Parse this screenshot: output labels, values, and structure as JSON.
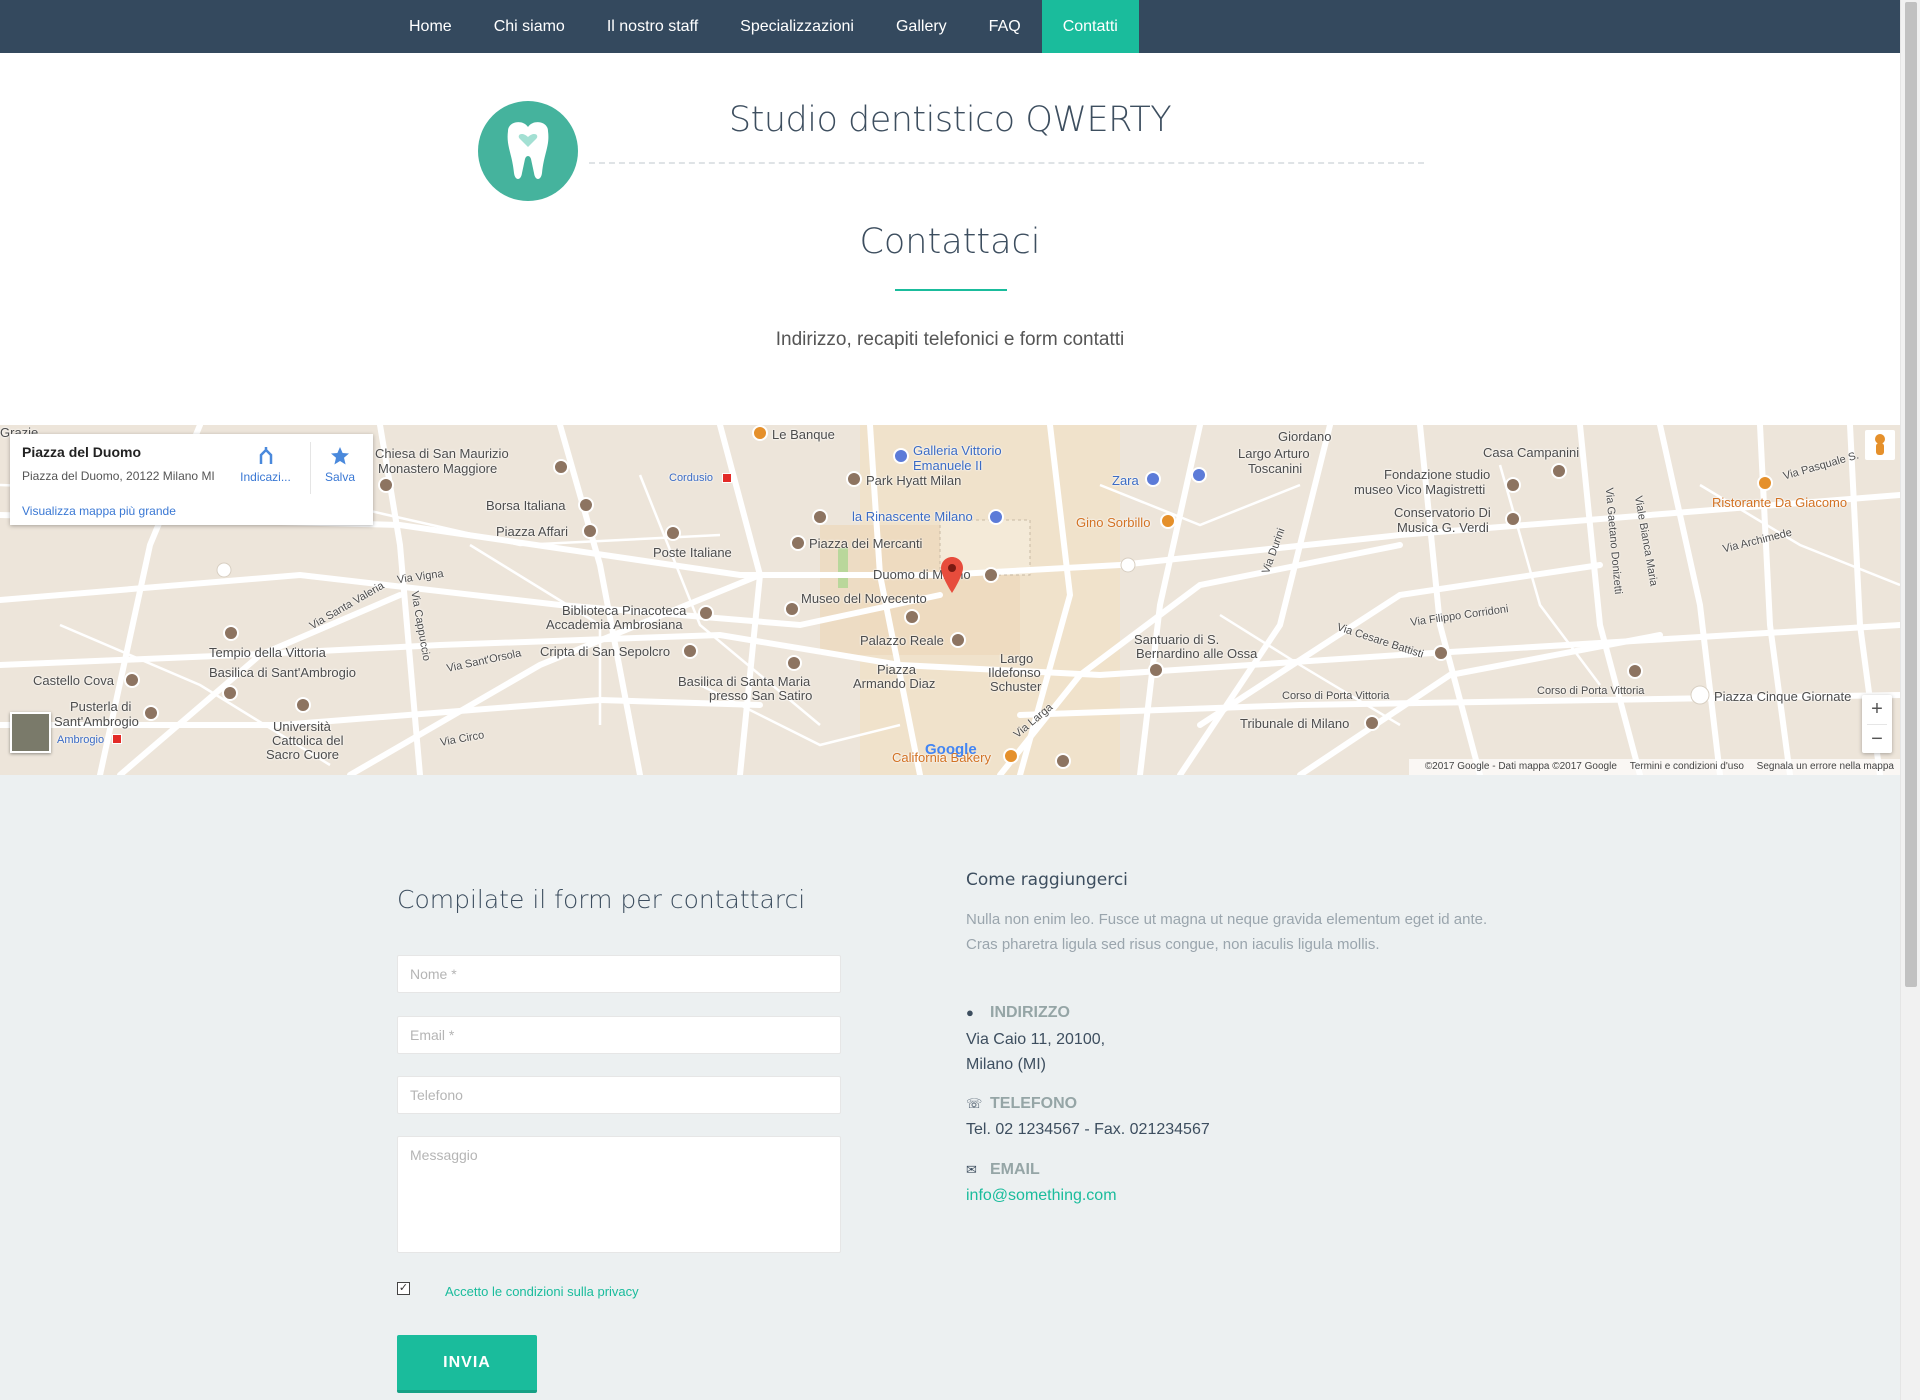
{
  "nav": {
    "items": [
      {
        "label": "Home",
        "active": false
      },
      {
        "label": "Chi siamo",
        "active": false
      },
      {
        "label": "Il nostro staff",
        "active": false
      },
      {
        "label": "Specializzazioni",
        "active": false
      },
      {
        "label": "Gallery",
        "active": false
      },
      {
        "label": "FAQ",
        "active": false
      },
      {
        "label": "Contatti",
        "active": true
      }
    ]
  },
  "header": {
    "brand": "Studio dentistico QWERTY",
    "logo_icon": "tooth-heart-icon"
  },
  "intro": {
    "title": "Contattaci",
    "subtitle": "Indirizzo, recapiti telefonici e form contatti"
  },
  "map": {
    "place_name": "Piazza del Duomo",
    "place_address": "Piazza del Duomo, 20122 Milano MI",
    "directions_label": "Indicazi...",
    "save_label": "Salva",
    "larger_map_link": "Visualizza mappa più grande",
    "zoom_in": "+",
    "zoom_out": "−",
    "google_logo": "Google",
    "footer": {
      "copyright": "©2017 Google - Dati mappa ©2017 Google",
      "terms": "Termini e condizioni d'uso",
      "report": "Segnala un errore nella mappa"
    },
    "labels": {
      "le_banque": "Le Banque",
      "galleria": "Galleria Vittorio",
      "galleria2": "Emanuele II",
      "park_hyatt": "Park Hyatt Milan",
      "rinascente": "la Rinascente Milano",
      "zara": "Zara",
      "gino": "Gino Sorbillo",
      "largo_toscanini": "Largo Arturo",
      "largo_toscanini2": "Toscanini",
      "giordano": "Giordano",
      "casa_campanini": "Casa Campanini",
      "fondazione": "Fondazione studio",
      "fondazione2": "museo Vico Magistretti",
      "conservatorio": "Conservatorio Di",
      "conservatorio2": "Musica G. Verdi",
      "ristorante": "Ristorante Da Giacomo",
      "santa_maurizio": "Chiesa di San Maurizio",
      "santa_maurizio2": "Monastero Maggiore",
      "borsa": "Borsa Italiana",
      "piazza_affari": "Piazza Affari",
      "poste": "Poste Italiane",
      "cordusio": "Cordusio",
      "mercanti": "Piazza dei Mercanti",
      "duomo": "Duomo di Milano",
      "novecento": "Museo del Novecento",
      "palazzo_reale": "Palazzo Reale",
      "biblioteca": "Biblioteca Pinacoteca",
      "biblioteca2": "Accademia Ambrosiana",
      "cripta": "Cripta di San Sepolcro",
      "tempio": "Tempio della Vittoria",
      "basilica_ambrogio": "Basilica di Sant'Ambrogio",
      "castello_cova": "Castello Cova",
      "pusterla": "Pusterla di",
      "pusterla2": "Sant'Ambrogio",
      "cattolica": "Università",
      "cattolica2": "Cattolica del",
      "cattolica3": "Sacro Cuore",
      "ambrogio_metro": "Ambrogio",
      "basilica_satiro": "Basilica di Santa Maria",
      "basilica_satiro2": "presso San Satiro",
      "armando_diaz": "Piazza",
      "armando_diaz2": "Armando Diaz",
      "largo_schuster": "Largo",
      "largo_schuster2": "Ildefonso",
      "largo_schuster3": "Schuster",
      "santuario": "Santuario di S.",
      "santuario2": "Bernardino alle Ossa",
      "corso_vittoria": "Corso di Porta Vittoria",
      "tribunale": "Tribunale di Milano",
      "cinque_giornate": "Piazza Cinque Giornate",
      "california": "California Bakery",
      "corso_porta_vittoria": "Corso di Porta Vittoria",
      "via_corridoni": "Via Filippo Corridoni",
      "via_battisti": "Via Cesare Battisti",
      "via_vigna": "Via Vigna",
      "via_orsola": "Via Sant'Orsola",
      "via_valeria": "Via Santa Valeria",
      "via_cappuccio": "Via Cappuccio",
      "via_circo": "Via Circo",
      "via_archimede": "Via Archimede",
      "via_pasquale": "Via Pasquale S.",
      "via_donizetti": "Via Gaetano Donizetti",
      "viale_bianca": "Viale Bianca Maria",
      "via_durini": "Via Durini",
      "via_larga": "Via Larga",
      "grazie": "Grazie"
    }
  },
  "form": {
    "title": "Compilate il form per contattarci",
    "name_placeholder": "Nome *",
    "email_placeholder": "Email *",
    "phone_placeholder": "Telefono",
    "message_placeholder": "Messaggio",
    "privacy_label": "Accetto le condizioni sulla privacy",
    "privacy_checked": true,
    "submit_label": "INVIA"
  },
  "reach": {
    "title": "Come raggiungerci",
    "text": "Nulla non enim leo. Fusce ut magna ut neque gravida elementum eget id ante. Cras pharetra ligula sed risus congue, non iaculis ligula mollis.",
    "address_label": "INDIRIZZO",
    "address_line1": "Via Caio 11, 20100,",
    "address_line2": "Milano (MI)",
    "phone_label": "TELEFONO",
    "phone_value": "Tel. 02 1234567 - Fax. 021234567",
    "email_label": "EMAIL",
    "email_value": "info@something.com"
  },
  "colors": {
    "nav_bg": "#34495e",
    "accent": "#1abc9c",
    "section_bg": "#ecf0f1",
    "heading": "#3d4e5f"
  }
}
